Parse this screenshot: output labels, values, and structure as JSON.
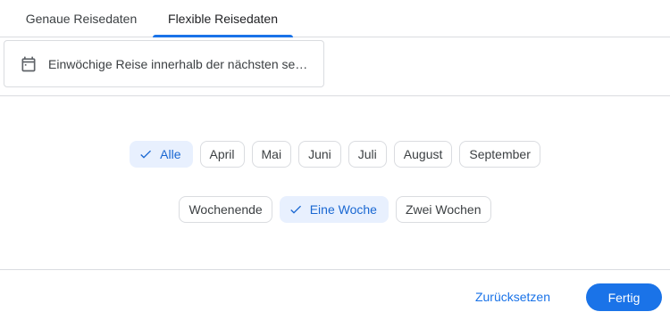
{
  "tabs": {
    "exact_label": "Genaue Reisedaten",
    "flexible_label": "Flexible Reisedaten",
    "active": "flexible"
  },
  "field": {
    "icon": "calendar-icon",
    "text": "Einwöchige Reise innerhalb der nächsten sec..."
  },
  "months": {
    "items": [
      "Alle",
      "April",
      "Mai",
      "Juni",
      "Juli",
      "August",
      "September"
    ],
    "selected": "Alle"
  },
  "durations": {
    "items": [
      "Wochenende",
      "Eine Woche",
      "Zwei Wochen"
    ],
    "selected": "Eine Woche"
  },
  "footer": {
    "reset_label": "Zurücksetzen",
    "done_label": "Fertig"
  },
  "colors": {
    "accent": "#1a73e8",
    "selected_chip_bg": "#e8f0fe",
    "border": "#dadce0"
  }
}
